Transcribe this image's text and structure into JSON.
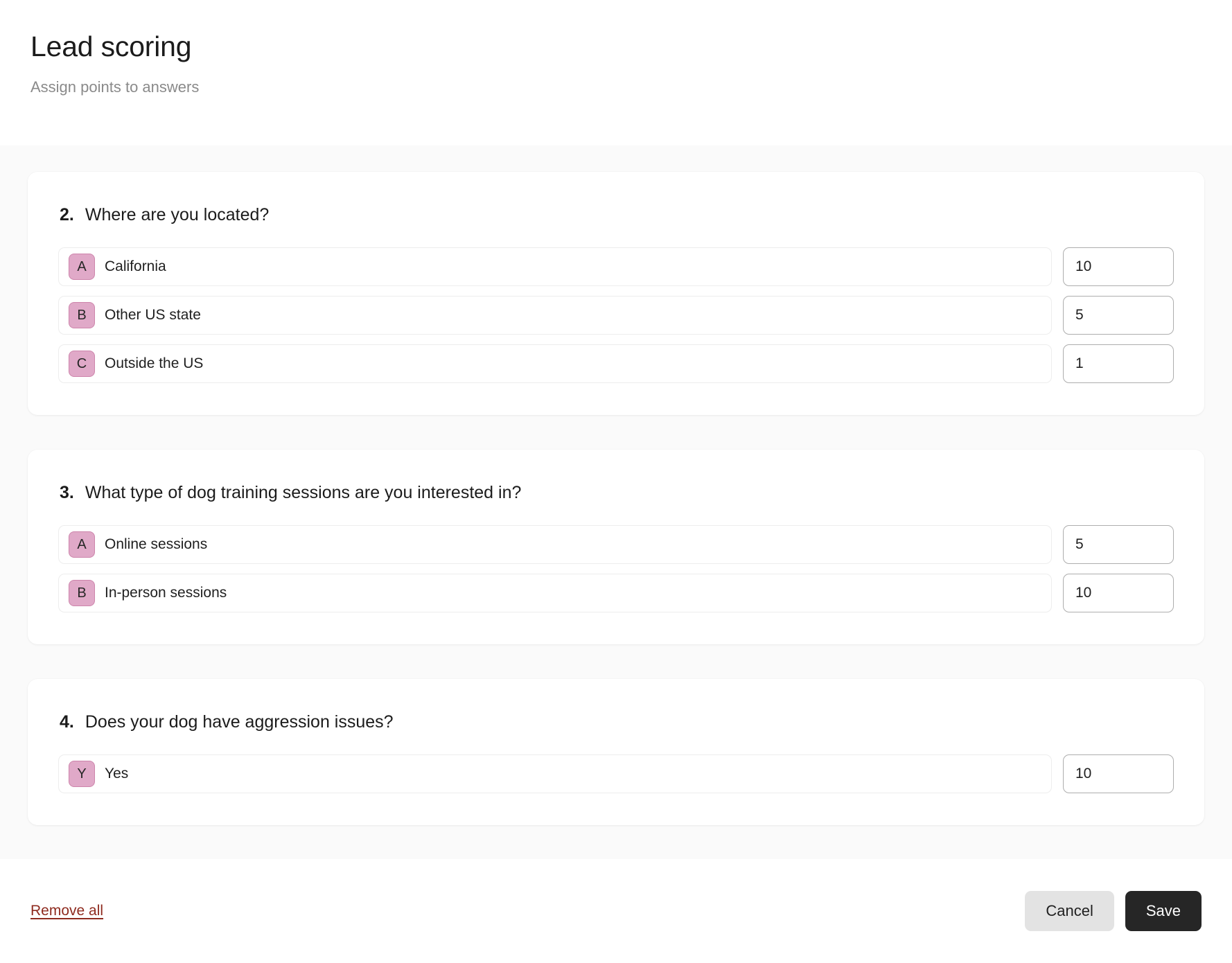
{
  "header": {
    "title": "Lead scoring",
    "subtitle": "Assign points to answers"
  },
  "colors": {
    "page_background": "#ffffff",
    "scroll_background": "#fafafa",
    "card_background": "#ffffff",
    "badge_fill": "#e0a9c8",
    "badge_border": "#cd84ab",
    "answer_row_border": "#ededed",
    "score_input_border": "#adadad",
    "remove_link": "#8e2a1e",
    "cancel_button": "#e3e3e3",
    "save_button": "#262626",
    "title_text": "#1b1b1b",
    "subtitle_text": "#8a8a8a"
  },
  "questions": [
    {
      "number": "2.",
      "text": "Where are you located?",
      "answers": [
        {
          "letter": "A",
          "label": "California",
          "score": "10"
        },
        {
          "letter": "B",
          "label": "Other US state",
          "score": "5"
        },
        {
          "letter": "C",
          "label": "Outside the US",
          "score": "1"
        }
      ]
    },
    {
      "number": "3.",
      "text": "What type of dog training sessions are you interested in?",
      "answers": [
        {
          "letter": "A",
          "label": "Online sessions",
          "score": "5"
        },
        {
          "letter": "B",
          "label": "In-person sessions",
          "score": "10"
        }
      ]
    },
    {
      "number": "4.",
      "text": "Does your dog have aggression issues?",
      "answers": [
        {
          "letter": "Y",
          "label": "Yes",
          "score": "10"
        }
      ]
    }
  ],
  "footer": {
    "remove_all_label": "Remove all",
    "cancel_label": "Cancel",
    "save_label": "Save"
  }
}
